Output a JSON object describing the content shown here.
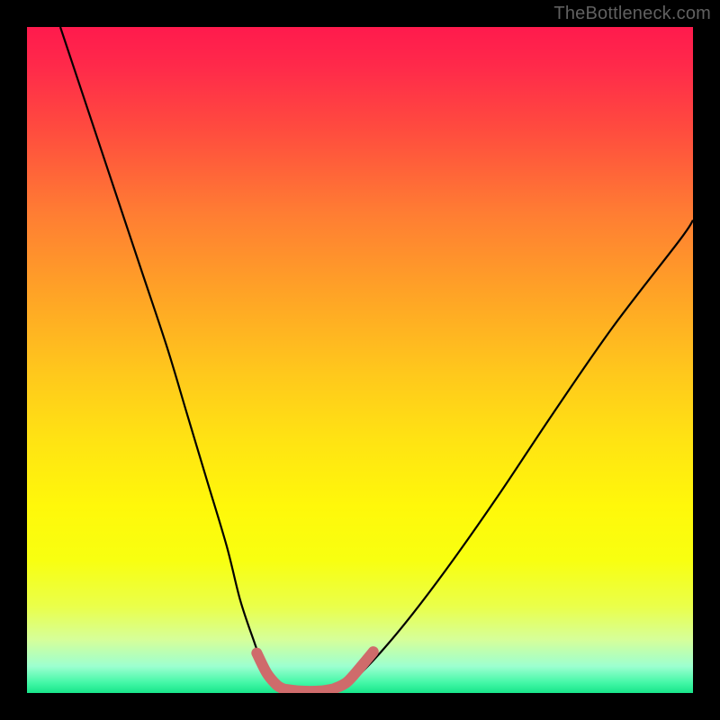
{
  "watermark": "TheBottleneck.com",
  "colors": {
    "page_bg": "#000000",
    "curve": "#000000",
    "marker": "#cf6b6b",
    "watermark_text": "#606060",
    "gradient_top": "#ff1a4d",
    "gradient_mid": "#ffe313",
    "gradient_bottom": "#18e58a"
  },
  "chart_data": {
    "type": "line",
    "title": "",
    "xlabel": "",
    "ylabel": "",
    "xlim": [
      0,
      100
    ],
    "ylim": [
      0,
      100
    ],
    "grid": false,
    "legend": false,
    "note": "V-shaped bottleneck curve. No axis ticks or numeric labels are visible; x/y values are estimated as % of plot area. y runs 0 (bottom) → 100 (top).",
    "series": [
      {
        "name": "left-branch",
        "x": [
          5,
          9,
          13,
          17,
          21,
          24,
          27,
          30,
          32,
          34,
          35.5,
          37,
          38
        ],
        "y": [
          100,
          88,
          76,
          64,
          52,
          42,
          32,
          22,
          14,
          8,
          4,
          1.5,
          0.5
        ]
      },
      {
        "name": "valley-flat",
        "x": [
          38,
          40,
          42,
          44,
          46
        ],
        "y": [
          0.5,
          0.3,
          0.2,
          0.3,
          0.5
        ]
      },
      {
        "name": "right-branch",
        "x": [
          46,
          49,
          53,
          58,
          64,
          71,
          79,
          88,
          98,
          100
        ],
        "y": [
          0.5,
          2,
          6,
          12,
          20,
          30,
          42,
          55,
          68,
          71
        ]
      }
    ],
    "highlighted_segments": [
      {
        "name": "left-dip-marker",
        "x": [
          34.5,
          36,
          37.5,
          38.5
        ],
        "y": [
          6,
          3,
          1.2,
          0.6
        ]
      },
      {
        "name": "valley-marker",
        "x": [
          38.5,
          41,
          44,
          46
        ],
        "y": [
          0.6,
          0.3,
          0.3,
          0.6
        ]
      },
      {
        "name": "right-rise-marker",
        "x": [
          46,
          48,
          50,
          52
        ],
        "y": [
          0.6,
          1.6,
          3.8,
          6.2
        ]
      }
    ]
  }
}
